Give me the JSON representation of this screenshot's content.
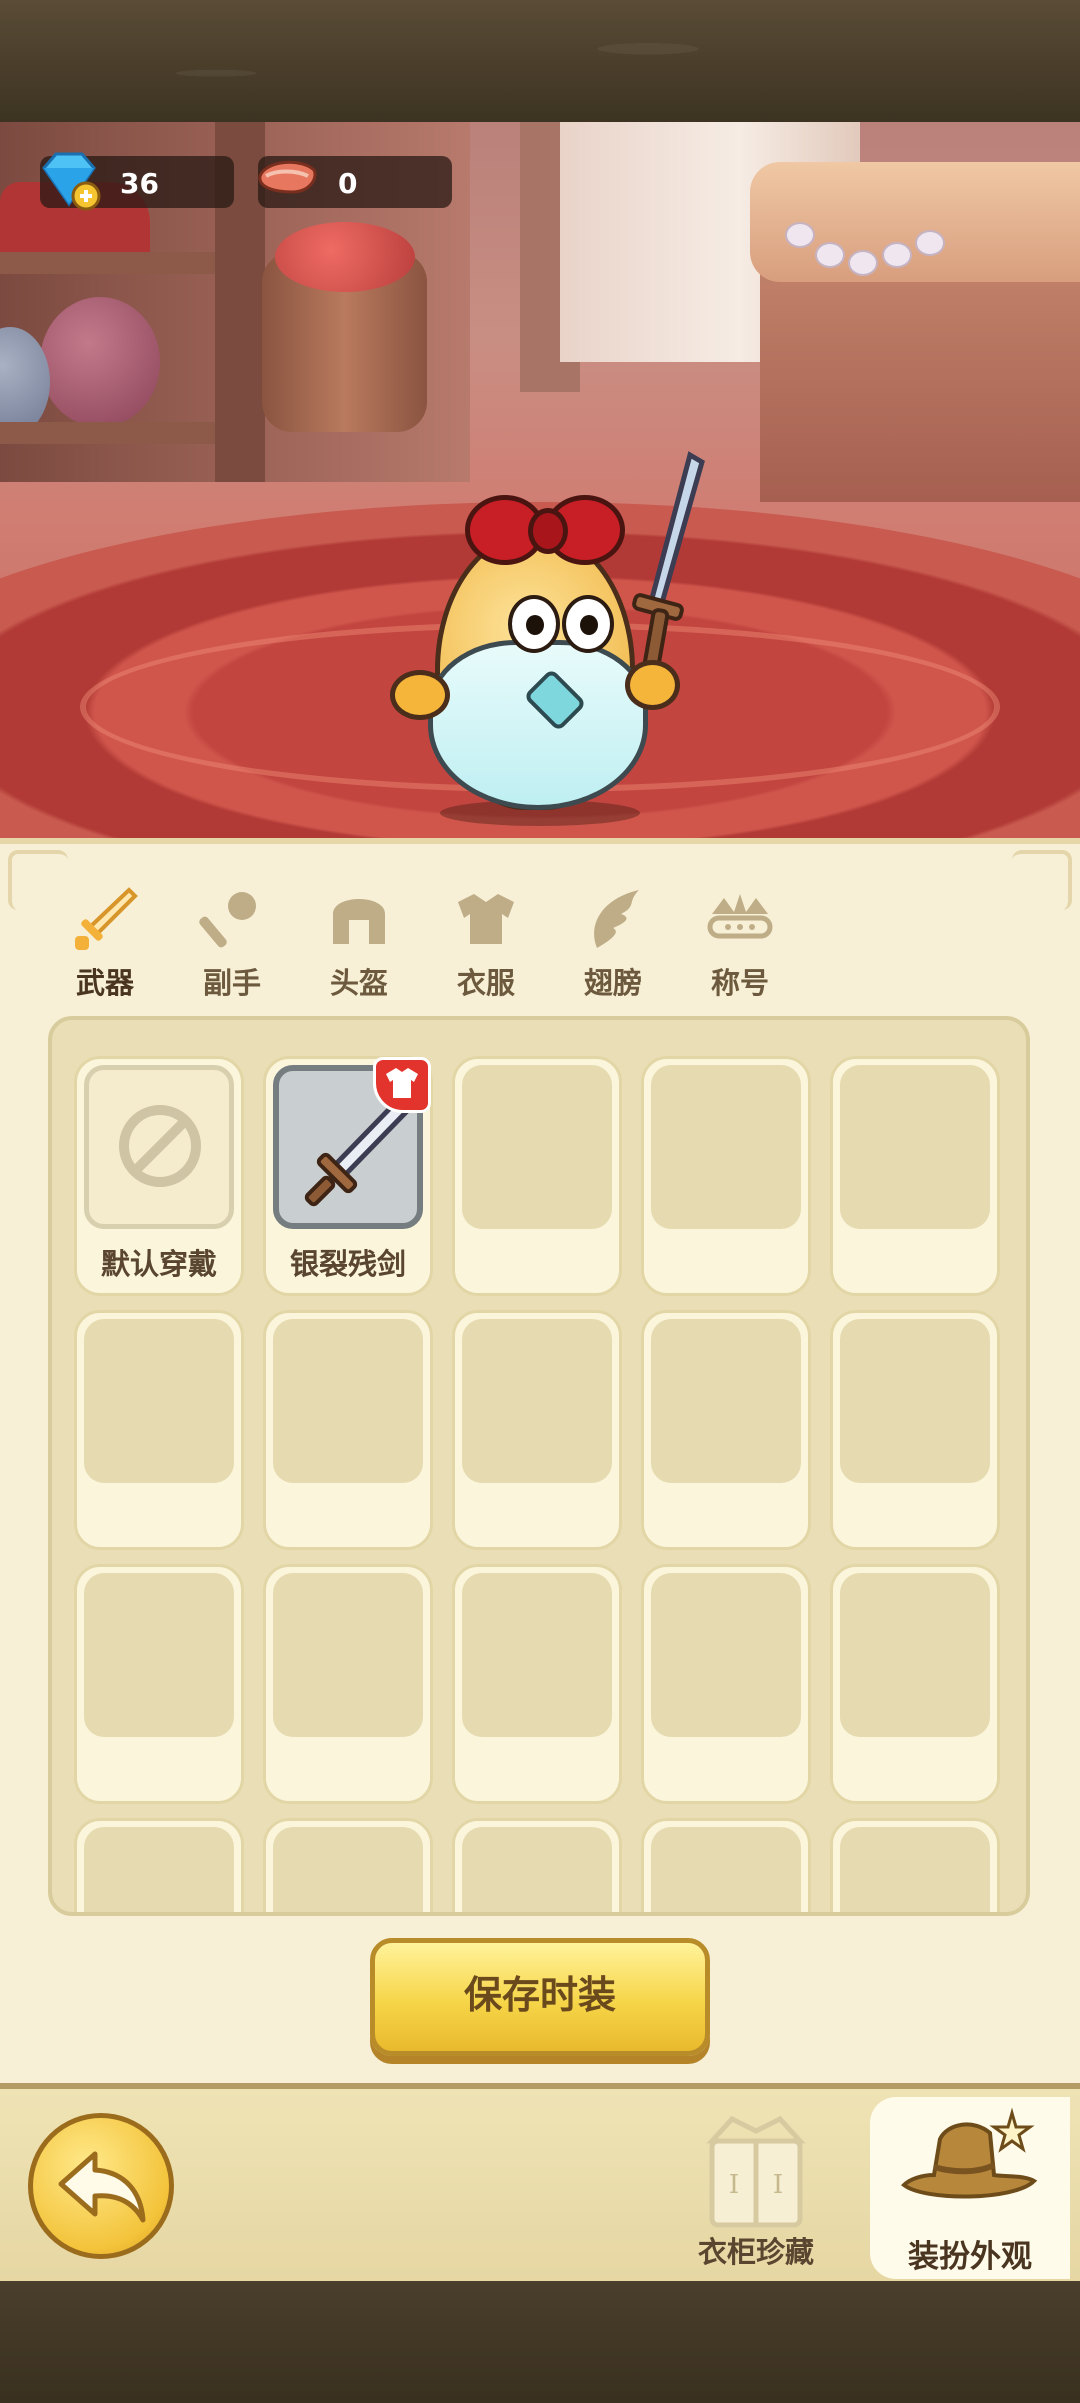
{
  "currency": {
    "gems": "36",
    "meat": "0"
  },
  "tabs": [
    {
      "label": "武器",
      "icon": "sword-icon",
      "active": true
    },
    {
      "label": "副手",
      "icon": "key-icon",
      "active": false
    },
    {
      "label": "头盔",
      "icon": "helmet-icon",
      "active": false
    },
    {
      "label": "衣服",
      "icon": "armor-icon",
      "active": false
    },
    {
      "label": "翅膀",
      "icon": "wing-icon",
      "active": false
    },
    {
      "label": "称号",
      "icon": "crown-icon",
      "active": false
    }
  ],
  "items": [
    {
      "label": "默认穿戴",
      "icon": "no-sign-icon"
    },
    {
      "label": "银裂残剑",
      "icon": "silver-sword-icon",
      "badge": "outfit-badge-icon"
    }
  ],
  "save_button": "保存时装",
  "bottom_nav": {
    "wardrobe_label": "衣柜珍藏",
    "dressup_label": "装扮外观"
  },
  "colors": {
    "accent": "#d8962a",
    "button_yellow": "#f6d548",
    "badge_red": "#e2332c"
  }
}
